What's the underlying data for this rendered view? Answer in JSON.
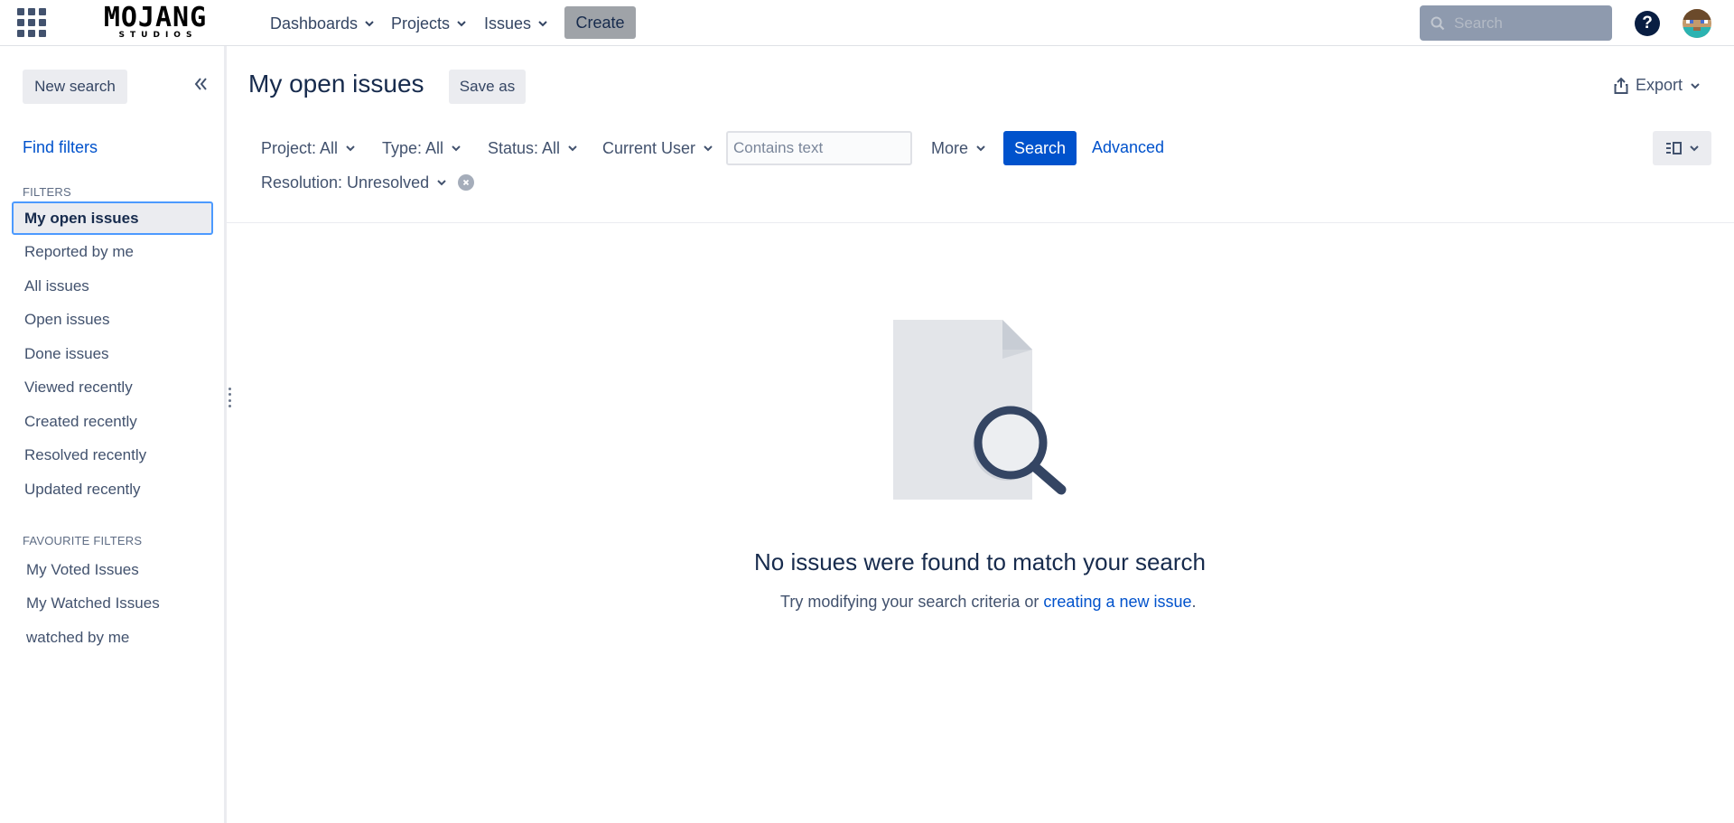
{
  "topnav": {
    "logo_main": "MOJANG",
    "logo_sub": "STUDIOS",
    "menus": [
      {
        "label": "Dashboards"
      },
      {
        "label": "Projects"
      },
      {
        "label": "Issues"
      }
    ],
    "create_label": "Create",
    "search_placeholder": "Search",
    "help_glyph": "?",
    "icons": [
      "app-grid-icon",
      "search-icon",
      "help-icon",
      "avatar"
    ]
  },
  "sidebar": {
    "new_search_label": "New search",
    "find_filters_label": "Find filters",
    "filters_heading": "FILTERS",
    "filters": [
      {
        "label": "My open issues",
        "active": true
      },
      {
        "label": "Reported by me"
      },
      {
        "label": "All issues"
      },
      {
        "label": "Open issues"
      },
      {
        "label": "Done issues"
      },
      {
        "label": "Viewed recently"
      },
      {
        "label": "Created recently"
      },
      {
        "label": "Resolved recently"
      },
      {
        "label": "Updated recently"
      }
    ],
    "favourites_heading": "FAVOURITE FILTERS",
    "favourites": [
      {
        "label": "My Voted Issues"
      },
      {
        "label": "My Watched Issues"
      },
      {
        "label": "watched by me"
      }
    ]
  },
  "main": {
    "title": "My open issues",
    "save_as_label": "Save as",
    "export_label": "Export",
    "filters": {
      "project": "Project: All",
      "type": "Type: All",
      "status": "Status: All",
      "assignee": "Current User",
      "contains_placeholder": "Contains text",
      "more": "More",
      "resolution": "Resolution: Unresolved"
    },
    "search_label": "Search",
    "advanced_label": "Advanced",
    "empty": {
      "title": "No issues were found to match your search",
      "text_prefix": "Try modifying your search criteria or ",
      "link": "creating a new issue",
      "text_suffix": "."
    }
  },
  "colors": {
    "primary": "#0052cc",
    "text": "#172b4d",
    "subtle_text": "#42526e",
    "active_border": "#4c9aff",
    "button_bg": "#ebecf0"
  }
}
